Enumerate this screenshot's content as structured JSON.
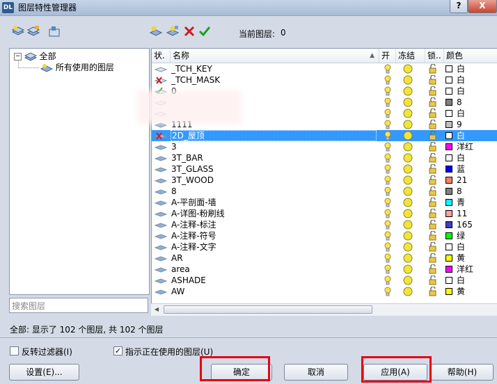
{
  "window": {
    "app_icon": "DL",
    "title": "图层特性管理器",
    "help": "?",
    "close": "X"
  },
  "toolbar": {
    "current_layer_label": "当前图层:",
    "current_layer_value": "0"
  },
  "tree": {
    "root": "全部",
    "child": "所有使用的图层"
  },
  "search": {
    "placeholder": "搜索图层"
  },
  "columns": {
    "state": "状.",
    "name": "名称",
    "on": "开",
    "freeze": "冻结",
    "lock": "锁..",
    "color": "颜色"
  },
  "layers": [
    {
      "name": "_TCH_KEY",
      "color": "白",
      "hex": "#ffffff"
    },
    {
      "name": "_TCH_MASK",
      "color": "白",
      "hex": "#ffffff"
    },
    {
      "name": "0",
      "color": "白",
      "hex": "#ffffff"
    },
    {
      "name": "",
      "color": "8",
      "hex": "#808080"
    },
    {
      "name": "",
      "color": "白",
      "hex": "#ffffff"
    },
    {
      "name": "1111",
      "color": "9",
      "hex": "#c0c0c0"
    },
    {
      "name": "2D_屋顶",
      "color": "白",
      "hex": "#ffffff"
    },
    {
      "name": "3",
      "color": "洋红",
      "hex": "#ff00ff"
    },
    {
      "name": "3T_BAR",
      "color": "白",
      "hex": "#ffffff"
    },
    {
      "name": "3T_GLASS",
      "color": "蓝",
      "hex": "#0000ff"
    },
    {
      "name": "3T_WOOD",
      "color": "21",
      "hex": "#ff7f5f"
    },
    {
      "name": "8",
      "color": "8",
      "hex": "#808080"
    },
    {
      "name": "A-平剖面-墙",
      "color": "青",
      "hex": "#00ffff"
    },
    {
      "name": "A-详图-粉刷线",
      "color": "11",
      "hex": "#ff9f9f"
    },
    {
      "name": "A-注释-标注",
      "color": "165",
      "hex": "#3f3fbf"
    },
    {
      "name": "A-注释-符号",
      "color": "绿",
      "hex": "#00ff00"
    },
    {
      "name": "A-注释-文字",
      "color": "白",
      "hex": "#ffffff"
    },
    {
      "name": "AR",
      "color": "黄",
      "hex": "#ffff00"
    },
    {
      "name": "area",
      "color": "洋红",
      "hex": "#ff00ff"
    },
    {
      "name": "ASHADE",
      "color": "白",
      "hex": "#ffffff"
    },
    {
      "name": "AW",
      "color": "黄",
      "hex": "#ffff00"
    }
  ],
  "status": {
    "text": "全部: 显示了 102 个图层, 共 102 个图层"
  },
  "filters": {
    "invert_label": "反转过滤器(I)",
    "show_used_label": "指示正在使用的图层(U)"
  },
  "buttons": {
    "settings": "设置(E)...",
    "ok": "确定",
    "cancel": "取消",
    "apply": "应用(A)",
    "help": "帮助(H)"
  },
  "colors": {
    "selection": "#3399ff",
    "highlight_frame": "#e60012",
    "bulb": "#ffe34d",
    "sun": "#f2e43a"
  }
}
